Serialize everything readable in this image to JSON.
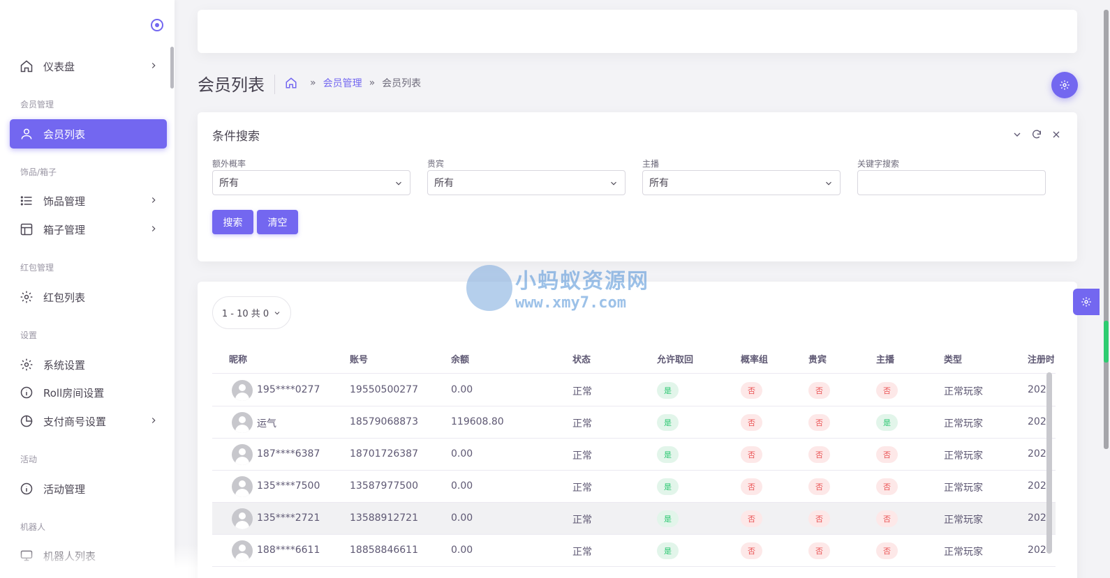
{
  "sidebar": {
    "items": {
      "dashboard": "仪表盘",
      "member_list": "会员列表",
      "ornament_mgmt": "饰品管理",
      "box_mgmt": "箱子管理",
      "redpacket_list": "红包列表",
      "system_settings": "系统设置",
      "roll_settings": "Roll房间设置",
      "payment_settings": "支付商号设置",
      "activity_mgmt": "活动管理",
      "robot_list": "机器人列表"
    },
    "sections": {
      "member": "会员管理",
      "ornament": "饰品/箱子",
      "redpacket": "红包管理",
      "settings": "设置",
      "activity": "活动",
      "robot": "机器人"
    }
  },
  "header": {
    "page_title": "会员列表",
    "breadcrumb": {
      "sep": "»",
      "parent": "会员管理",
      "current": "会员列表"
    }
  },
  "search": {
    "title": "条件搜索",
    "fields": {
      "extra_prob": {
        "label": "额外概率",
        "value": "所有"
      },
      "vip": {
        "label": "贵宾",
        "value": "所有"
      },
      "anchor": {
        "label": "主播",
        "value": "所有"
      },
      "keyword": {
        "label": "关键字搜索",
        "value": "",
        "placeholder": ""
      }
    },
    "buttons": {
      "search": "搜索",
      "clear": "清空"
    }
  },
  "table": {
    "pager_label": "1 - 10 共 0",
    "columns": [
      "昵称",
      "账号",
      "余额",
      "状态",
      "允许取回",
      "概率组",
      "贵宾",
      "主播",
      "类型",
      "注册时"
    ],
    "rows": [
      {
        "nickname": "195****0277",
        "account": "19550500277",
        "balance": "0.00",
        "status": "正常",
        "allow_retrieve": "是",
        "prob_group": "否",
        "vip": "否",
        "anchor": "否",
        "type": "正常玩家",
        "registered": "202"
      },
      {
        "nickname": "运气",
        "account": "18579068873",
        "balance": "119608.80",
        "status": "正常",
        "allow_retrieve": "是",
        "prob_group": "否",
        "vip": "否",
        "anchor": "是",
        "type": "正常玩家",
        "registered": "202"
      },
      {
        "nickname": "187****6387",
        "account": "18701726387",
        "balance": "0.00",
        "status": "正常",
        "allow_retrieve": "是",
        "prob_group": "否",
        "vip": "否",
        "anchor": "否",
        "type": "正常玩家",
        "registered": "202"
      },
      {
        "nickname": "135****7500",
        "account": "13587977500",
        "balance": "0.00",
        "status": "正常",
        "allow_retrieve": "是",
        "prob_group": "否",
        "vip": "否",
        "anchor": "否",
        "type": "正常玩家",
        "registered": "202"
      },
      {
        "nickname": "135****2721",
        "account": "13588912721",
        "balance": "0.00",
        "status": "正常",
        "allow_retrieve": "是",
        "prob_group": "否",
        "vip": "否",
        "anchor": "否",
        "type": "正常玩家",
        "registered": "202"
      },
      {
        "nickname": "188****6611",
        "account": "18858846611",
        "balance": "0.00",
        "status": "正常",
        "allow_retrieve": "是",
        "prob_group": "否",
        "vip": "否",
        "anchor": "否",
        "type": "正常玩家",
        "registered": "202"
      }
    ]
  },
  "watermark": {
    "cn": "小蚂蚁资源网",
    "en": "www.xmy7.com"
  },
  "colors": {
    "primary": "#7367f0",
    "success": "#28c76f",
    "danger": "#ea5455"
  }
}
